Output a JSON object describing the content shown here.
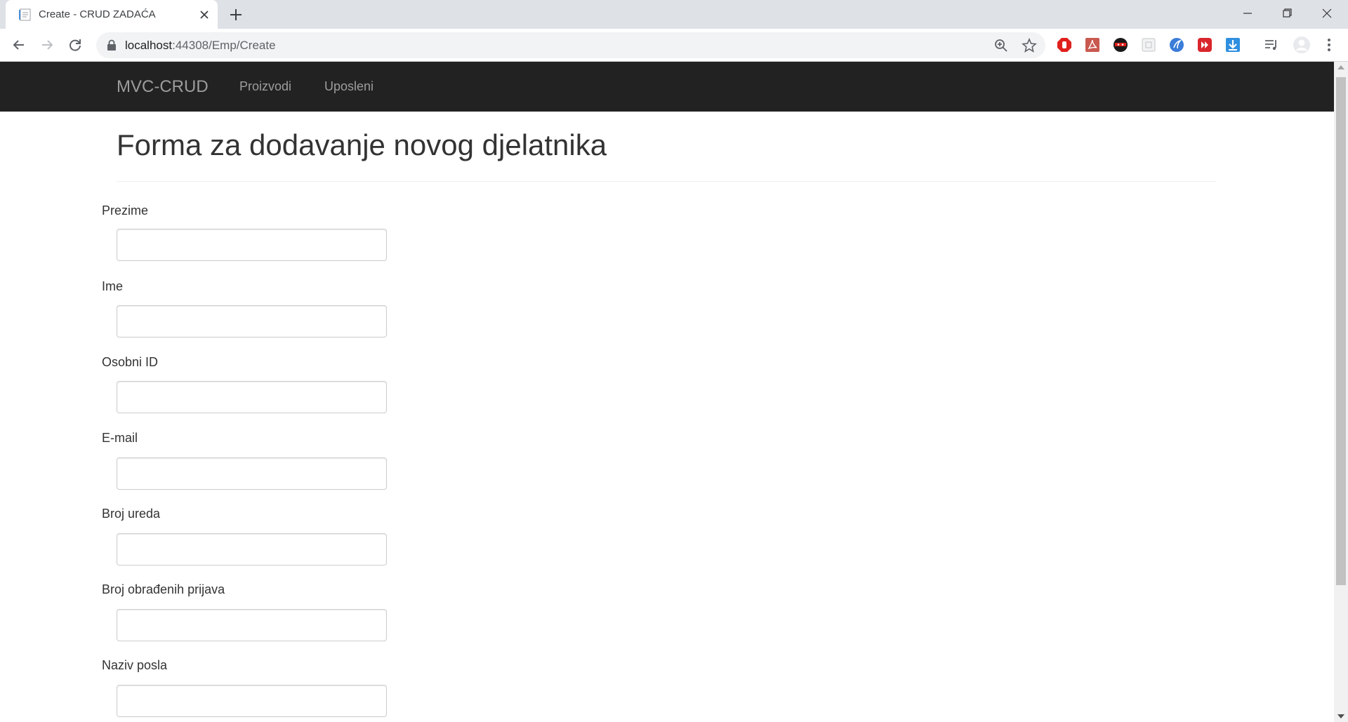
{
  "browser": {
    "tab_title": "Create - CRUD ZADAĆA",
    "url_host": "localhost",
    "url_path": ":44308/Emp/Create"
  },
  "navbar": {
    "brand": "MVC-CRUD",
    "links": [
      "Proizvodi",
      "Uposleni"
    ]
  },
  "form": {
    "title": "Forma za dodavanje novog djelatnika",
    "fields": [
      {
        "label": "Prezime",
        "value": ""
      },
      {
        "label": "Ime",
        "value": ""
      },
      {
        "label": "Osobni ID",
        "value": ""
      },
      {
        "label": "E-mail",
        "value": ""
      },
      {
        "label": "Broj ureda",
        "value": ""
      },
      {
        "label": "Broj obrađenih prijava",
        "value": ""
      },
      {
        "label": "Naziv posla",
        "value": ""
      }
    ]
  },
  "colors": {
    "navbar_bg": "#222222",
    "navbar_text": "#9d9d9d",
    "tabstrip_bg": "#dee1e6",
    "omnibox_bg": "#f1f3f4"
  }
}
